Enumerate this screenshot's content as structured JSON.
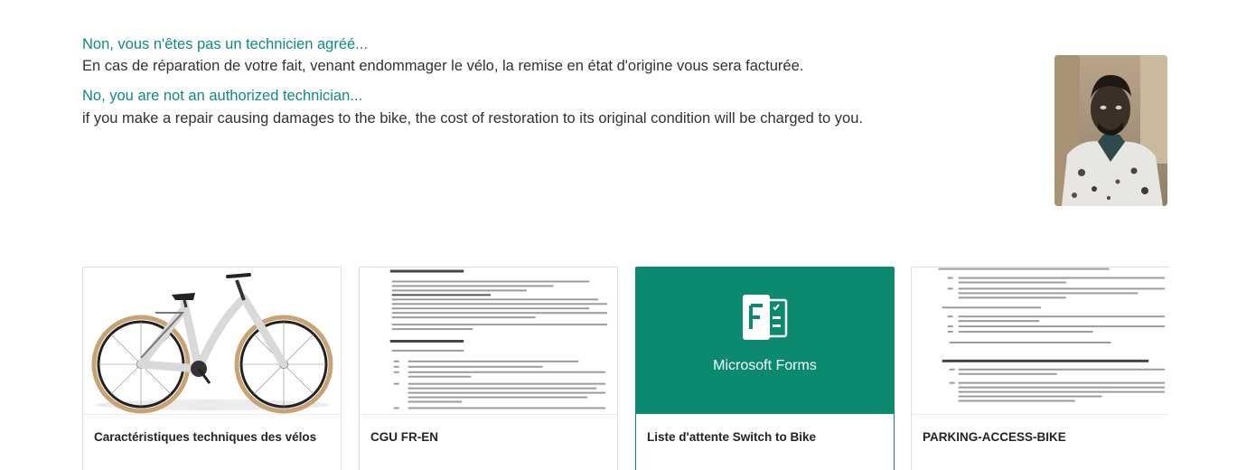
{
  "notice": {
    "fr_title": "Non, vous n'êtes pas un technicien agréé...",
    "fr_body": "En cas de réparation de votre fait, venant endommager le vélo, la remise en état d'origine vous sera facturée.",
    "en_title": "No, you are not an authorized technician...",
    "en_body": "if you make a repair causing damages to the bike, the cost of restoration to its original condition will be charged to you."
  },
  "colors": {
    "accent_teal": "#0f8a82",
    "forms_green": "#0b8a6f"
  },
  "cards": [
    {
      "label": "Caractéristiques techniques des vélos",
      "thumbnail": "bike-image"
    },
    {
      "label": "CGU FR-EN",
      "thumbnail": "document-preview"
    },
    {
      "label": "Liste d'attente Switch to Bike",
      "thumbnail": "microsoft-forms",
      "thumbnail_text": "Microsoft Forms"
    },
    {
      "label": "PARKING-ACCESS-BIKE",
      "thumbnail": "document-preview"
    }
  ]
}
